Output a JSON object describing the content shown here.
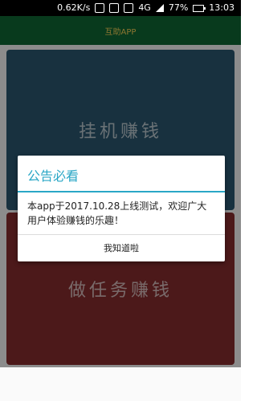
{
  "status_bar": {
    "speed": "0.62K/s",
    "network": "4G",
    "battery": "77%",
    "time": "13:03"
  },
  "app_bar": {
    "title": "互助APP"
  },
  "cards": {
    "top_label": "挂机赚钱",
    "bottom_label": "做任务赚钱"
  },
  "dialog": {
    "title": "公告必看",
    "message": "本app于2017.10.28上线测试，欢迎广大用户体验赚钱的乐趣！",
    "button_label": "我知道啦"
  }
}
